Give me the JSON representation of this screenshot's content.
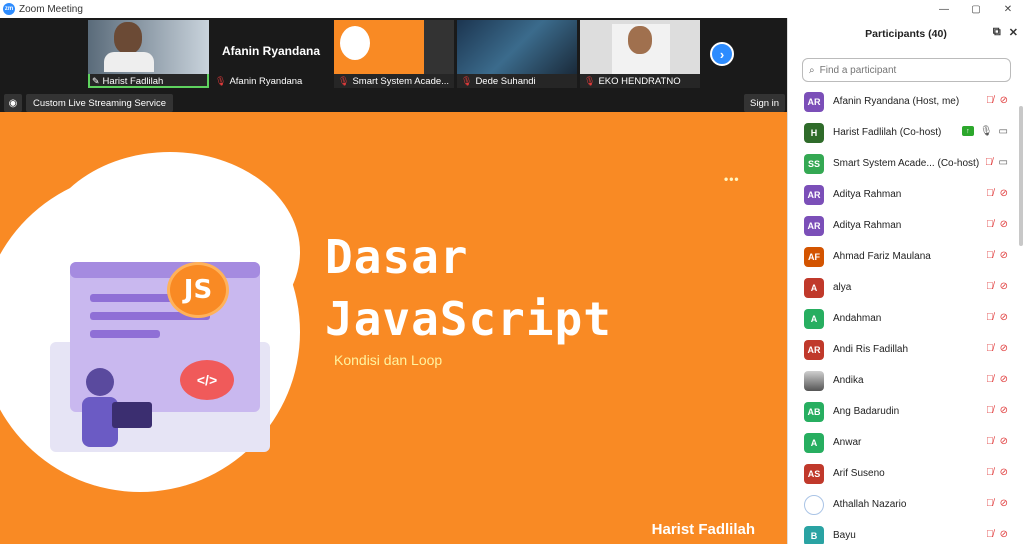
{
  "window": {
    "title": "Zoom Meeting",
    "logo": "zm",
    "controls": [
      "—",
      "▢",
      "✕"
    ]
  },
  "strip": {
    "thumbnails": [
      {
        "name": "Harist Fadlilah",
        "active": true,
        "icon": "pin-icon"
      },
      {
        "name": "Afanin Ryandana",
        "big_label": "Afanin Ryandana",
        "icon": "muted-mic-icon"
      },
      {
        "name": "Smart System Acade...",
        "icon": "muted-mic-icon"
      },
      {
        "name": "Dede Suhandi",
        "icon": "muted-mic-icon"
      },
      {
        "name": "EKO HENDRATNO",
        "icon": "muted-mic-icon"
      }
    ],
    "next_glyph": "›"
  },
  "toolbar": {
    "live_label": "Custom Live Streaming Service",
    "signin_label": "Sign in"
  },
  "slide": {
    "title_line1": "Dasar",
    "title_line2": "JavaScript",
    "subtitle": "Kondisi dan Loop",
    "speaker": "Harist Fadlilah",
    "js_badge": "JS",
    "code_badge": "</>",
    "dots": "•••"
  },
  "panel": {
    "title": "Participants (40)",
    "search_placeholder": "Find a participant",
    "participants": [
      {
        "initials": "AR",
        "name": "Afanin Ryandana (Host, me)",
        "color": "#7b4fb8",
        "mic": "muted",
        "cam": "off"
      },
      {
        "initials": "H",
        "name": "Harist Fadlilah (Co-host)",
        "color": "#2f6b2a",
        "mic": "on",
        "cam": "on",
        "sharing": true
      },
      {
        "initials": "SS",
        "name": "Smart System Acade...  (Co-host)",
        "color": "#34a853",
        "mic": "muted",
        "cam": "on"
      },
      {
        "initials": "AR",
        "name": "Aditya Rahman",
        "color": "#7b4fb8",
        "mic": "muted",
        "cam": "off"
      },
      {
        "initials": "AR",
        "name": "Aditya Rahman",
        "color": "#7b4fb8",
        "mic": "muted",
        "cam": "off"
      },
      {
        "initials": "AF",
        "name": "Ahmad Fariz Maulana",
        "color": "#d35400",
        "mic": "muted",
        "cam": "off"
      },
      {
        "initials": "A",
        "name": "alya",
        "color": "#c0392b",
        "mic": "muted",
        "cam": "off"
      },
      {
        "initials": "A",
        "name": "Andahman",
        "color": "#27ae60",
        "mic": "muted",
        "cam": "off"
      },
      {
        "initials": "AR",
        "name": "Andi Ris Fadillah",
        "color": "#c0392b",
        "mic": "muted",
        "cam": "off"
      },
      {
        "initials": "",
        "name": "Andika",
        "color": "#888888",
        "mic": "muted",
        "cam": "off",
        "photo": true
      },
      {
        "initials": "AB",
        "name": "Ang Badarudin",
        "color": "#27ae60",
        "mic": "muted",
        "cam": "off"
      },
      {
        "initials": "A",
        "name": "Anwar",
        "color": "#27ae60",
        "mic": "muted",
        "cam": "off"
      },
      {
        "initials": "AS",
        "name": "Arif Suseno",
        "color": "#c0392b",
        "mic": "muted",
        "cam": "off"
      },
      {
        "initials": "",
        "name": "Athallah Nazario",
        "color": "#ffffff",
        "mic": "muted",
        "cam": "off",
        "ring": true
      },
      {
        "initials": "B",
        "name": "Bayu",
        "color": "#2aa3a3",
        "mic": "muted",
        "cam": "off"
      }
    ]
  }
}
